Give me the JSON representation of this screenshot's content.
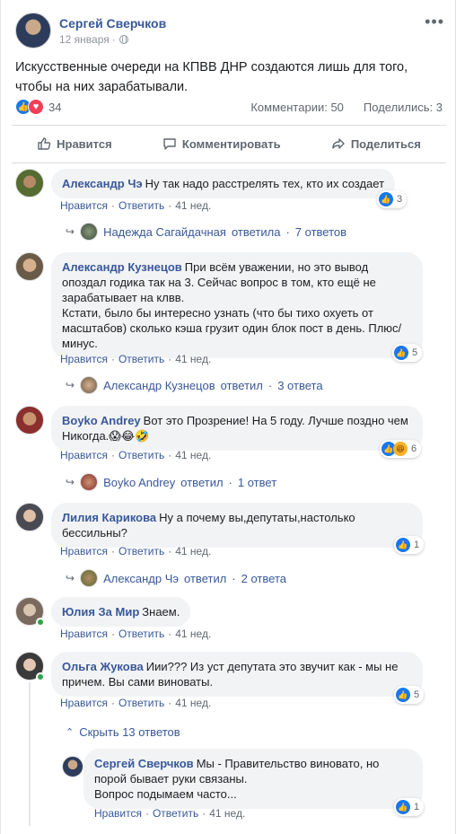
{
  "post": {
    "author": "Сергей Сверчков",
    "date": "12 января",
    "dot": "·",
    "more": "•••",
    "text": "Искусственные очереди на КПВВ ДНР создаются лишь для того, чтобы на них зарабатывали.",
    "reaction_count": "34",
    "comments_stat": "Комментарии: 50",
    "shares_stat": "Поделились: 3",
    "actions": {
      "like": "Нравится",
      "comment": "Комментировать",
      "share": "Поделиться"
    }
  },
  "comment_actions": {
    "like": "Нравится",
    "reply": "Ответить",
    "sep": "·",
    "time": "41 нед."
  },
  "comments": [
    {
      "author": "Александр Чэ",
      "text": "Ну так надо расстрелять тех, кто их создает",
      "reactions": "3",
      "reply": {
        "author": "Надежда Сагайдачная",
        "text": "ответила",
        "sep": "·",
        "count": "7 ответов"
      }
    },
    {
      "author": "Александр Кузнецов",
      "text1": "При всём уважении, но это вывод опоздал годика так на 3. Сейчас вопрос в том, кто ещё не зарабатывает на клвв.",
      "text2": "Кстати, было бы интересно узнать (что бы тихо охуеть от масштабов) сколько кэша грузит один блок пост в день. Плюс/минус.",
      "reactions": "5",
      "reply": {
        "author": "Александр Кузнецов",
        "text": "ответил",
        "sep": "·",
        "count": "3 ответа"
      }
    },
    {
      "author": "Boyko Andrey",
      "text": "Вот это Прозрение! На 5 году. Лучше поздно чем Никогда.😱😂🤣",
      "reactions": "6",
      "reply": {
        "author": "Boyko Andrey",
        "text": "ответил",
        "sep": "·",
        "count": "1 ответ"
      }
    },
    {
      "author": "Лилия Карикова",
      "text": "Ну а почему вы,депутаты,настолько бессильны?",
      "reactions": "1",
      "reply": {
        "author": "Александр Чэ",
        "text": "ответил",
        "sep": "·",
        "count": "2 ответа"
      }
    },
    {
      "author": "Юлия За Мир",
      "text": "Знаем."
    },
    {
      "author": "Ольга Жукова",
      "text": "Иии??? Из уст депутата это звучит как - мы не причем. Вы сами виноваты.",
      "reactions": "5"
    }
  ],
  "hide_replies": "Скрыть 13 ответов",
  "nested_reply": {
    "author": "Сергей Сверчков",
    "text": "Мы - Правительство виновато, но порой бывает руки связаны.",
    "text2": "Вопрос подымаем часто...",
    "reactions": "1"
  },
  "colors": {
    "link": "#385898",
    "like_blue": "#1877f2",
    "love_red": "#f33e58",
    "bubble_bg": "#f2f3f5",
    "muted": "#606770",
    "online": "#31a24c"
  }
}
